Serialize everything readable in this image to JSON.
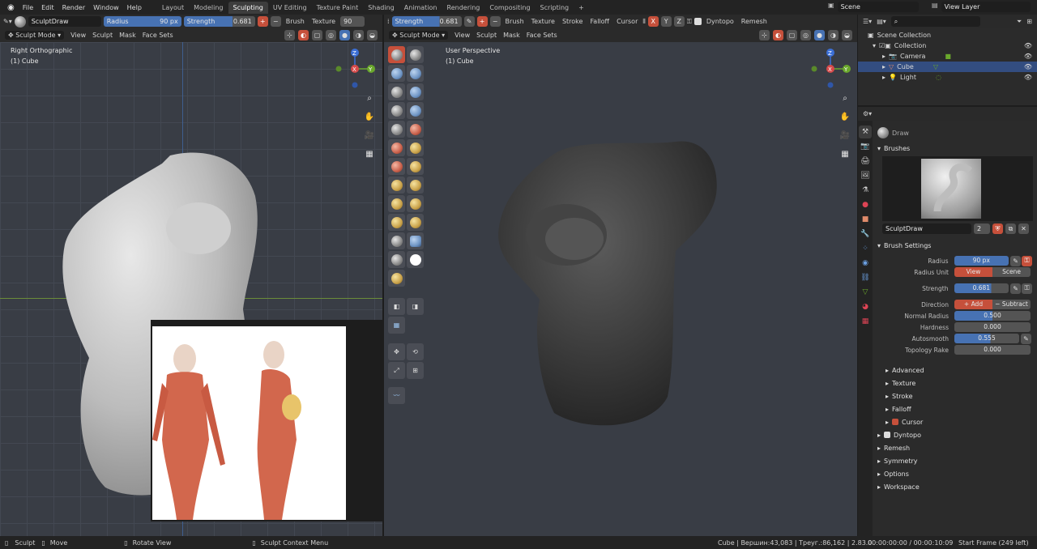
{
  "menu": {
    "items": [
      "File",
      "Edit",
      "Render",
      "Window",
      "Help"
    ]
  },
  "workspaces": [
    {
      "label": "Layout",
      "active": false
    },
    {
      "label": "Modeling",
      "active": false
    },
    {
      "label": "Sculpting",
      "active": true
    },
    {
      "label": "UV Editing",
      "active": false
    },
    {
      "label": "Texture Paint",
      "active": false
    },
    {
      "label": "Shading",
      "active": false
    },
    {
      "label": "Animation",
      "active": false
    },
    {
      "label": "Rendering",
      "active": false
    },
    {
      "label": "Compositing",
      "active": false
    },
    {
      "label": "Scripting",
      "active": false
    }
  ],
  "add_workspace": "+",
  "scene": {
    "label": "Scene"
  },
  "view_layer": {
    "label": "View Layer"
  },
  "toolbar_left": {
    "brush_name": "SculptDraw",
    "radius_label": "Radius",
    "radius_value": "90 px",
    "strength_label": "Strength",
    "strength_value": "0.681",
    "brush_dd": "Brush",
    "texture_dd": "Texture",
    "radius2_value": "90 px"
  },
  "toolbar_right": {
    "strength_label": "Strength",
    "strength_value": "0.681",
    "brush_dd": "Brush",
    "texture_dd": "Texture",
    "stroke_dd": "Stroke",
    "falloff_dd": "Falloff",
    "cursor_dd": "Cursor",
    "x": "X",
    "y": "Y",
    "z": "Z",
    "dyntopo": "Dyntopo",
    "remesh": "Remesh"
  },
  "left_viewport": {
    "mode": "Sculpt Mode",
    "menus": [
      "View",
      "Sculpt",
      "Mask",
      "Face Sets"
    ],
    "title": "Right Orthographic",
    "object": "(1) Cube"
  },
  "right_viewport": {
    "mode": "Sculpt Mode",
    "menus": [
      "View",
      "Sculpt",
      "Mask",
      "Face Sets"
    ],
    "title": "User Perspective",
    "object": "(1) Cube"
  },
  "gizmo": {
    "x": "X",
    "y": "Y",
    "z": "Z"
  },
  "outliner": {
    "root": "Scene Collection",
    "collection": "Collection",
    "items": [
      {
        "label": "Camera",
        "selected": false
      },
      {
        "label": "Cube",
        "selected": true
      },
      {
        "label": "Light",
        "selected": false
      }
    ]
  },
  "properties": {
    "tool_name": "Draw",
    "brushes_section": "Brushes",
    "brush_name": "SculptDraw",
    "brush_users": "2",
    "brush_settings_section": "Brush Settings",
    "radius_label": "Radius",
    "radius_value": "90 px",
    "radius_unit_label": "Radius Unit",
    "unit_view": "View",
    "unit_scene": "Scene",
    "strength_label": "Strength",
    "strength_value": "0.681",
    "strength_fraction": 0.681,
    "direction_label": "Direction",
    "dir_add": "Add",
    "dir_subtract": "Subtract",
    "normal_radius_label": "Normal Radius",
    "normal_radius_value": "0.500",
    "normal_radius_fraction": 0.5,
    "hardness_label": "Hardness",
    "hardness_value": "0.000",
    "autosmooth_label": "Autosmooth",
    "autosmooth_value": "0.555",
    "autosmooth_fraction": 0.555,
    "topology_rake_label": "Topology Rake",
    "topology_rake_value": "0.000",
    "subpanels": [
      "Advanced",
      "Texture",
      "Stroke",
      "Falloff",
      "Cursor"
    ],
    "sections": [
      "Dyntopo",
      "Remesh",
      "Symmetry",
      "Options",
      "Workspace"
    ]
  },
  "statusbar": {
    "sculpt": "Sculpt",
    "move": "Move",
    "rotate": "Rotate View",
    "context": "Sculpt Context Menu",
    "stats": "Cube | Вершин:43,083 | Треуг.:86,162 | 2.83.0",
    "time": "00:00:00:00 / 00:00:10:09",
    "frame": "Start Frame (249 left)"
  },
  "colors": {
    "accent_blue": "#4772b3",
    "accent_red": "#c6503b",
    "viewport": "#393d45"
  }
}
